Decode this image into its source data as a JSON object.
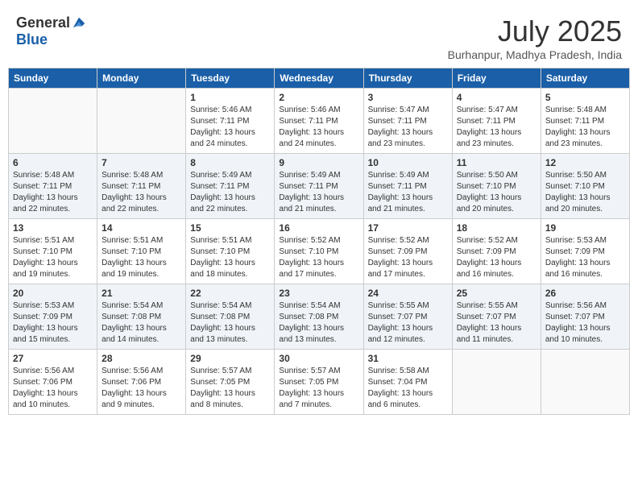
{
  "header": {
    "logo_general": "General",
    "logo_blue": "Blue",
    "month_year": "July 2025",
    "location": "Burhanpur, Madhya Pradesh, India"
  },
  "days_of_week": [
    "Sunday",
    "Monday",
    "Tuesday",
    "Wednesday",
    "Thursday",
    "Friday",
    "Saturday"
  ],
  "weeks": [
    {
      "shade": false,
      "days": [
        {
          "num": "",
          "sunrise": "",
          "sunset": "",
          "daylight": ""
        },
        {
          "num": "",
          "sunrise": "",
          "sunset": "",
          "daylight": ""
        },
        {
          "num": "1",
          "sunrise": "Sunrise: 5:46 AM",
          "sunset": "Sunset: 7:11 PM",
          "daylight": "Daylight: 13 hours and 24 minutes."
        },
        {
          "num": "2",
          "sunrise": "Sunrise: 5:46 AM",
          "sunset": "Sunset: 7:11 PM",
          "daylight": "Daylight: 13 hours and 24 minutes."
        },
        {
          "num": "3",
          "sunrise": "Sunrise: 5:47 AM",
          "sunset": "Sunset: 7:11 PM",
          "daylight": "Daylight: 13 hours and 23 minutes."
        },
        {
          "num": "4",
          "sunrise": "Sunrise: 5:47 AM",
          "sunset": "Sunset: 7:11 PM",
          "daylight": "Daylight: 13 hours and 23 minutes."
        },
        {
          "num": "5",
          "sunrise": "Sunrise: 5:48 AM",
          "sunset": "Sunset: 7:11 PM",
          "daylight": "Daylight: 13 hours and 23 minutes."
        }
      ]
    },
    {
      "shade": true,
      "days": [
        {
          "num": "6",
          "sunrise": "Sunrise: 5:48 AM",
          "sunset": "Sunset: 7:11 PM",
          "daylight": "Daylight: 13 hours and 22 minutes."
        },
        {
          "num": "7",
          "sunrise": "Sunrise: 5:48 AM",
          "sunset": "Sunset: 7:11 PM",
          "daylight": "Daylight: 13 hours and 22 minutes."
        },
        {
          "num": "8",
          "sunrise": "Sunrise: 5:49 AM",
          "sunset": "Sunset: 7:11 PM",
          "daylight": "Daylight: 13 hours and 22 minutes."
        },
        {
          "num": "9",
          "sunrise": "Sunrise: 5:49 AM",
          "sunset": "Sunset: 7:11 PM",
          "daylight": "Daylight: 13 hours and 21 minutes."
        },
        {
          "num": "10",
          "sunrise": "Sunrise: 5:49 AM",
          "sunset": "Sunset: 7:11 PM",
          "daylight": "Daylight: 13 hours and 21 minutes."
        },
        {
          "num": "11",
          "sunrise": "Sunrise: 5:50 AM",
          "sunset": "Sunset: 7:10 PM",
          "daylight": "Daylight: 13 hours and 20 minutes."
        },
        {
          "num": "12",
          "sunrise": "Sunrise: 5:50 AM",
          "sunset": "Sunset: 7:10 PM",
          "daylight": "Daylight: 13 hours and 20 minutes."
        }
      ]
    },
    {
      "shade": false,
      "days": [
        {
          "num": "13",
          "sunrise": "Sunrise: 5:51 AM",
          "sunset": "Sunset: 7:10 PM",
          "daylight": "Daylight: 13 hours and 19 minutes."
        },
        {
          "num": "14",
          "sunrise": "Sunrise: 5:51 AM",
          "sunset": "Sunset: 7:10 PM",
          "daylight": "Daylight: 13 hours and 19 minutes."
        },
        {
          "num": "15",
          "sunrise": "Sunrise: 5:51 AM",
          "sunset": "Sunset: 7:10 PM",
          "daylight": "Daylight: 13 hours and 18 minutes."
        },
        {
          "num": "16",
          "sunrise": "Sunrise: 5:52 AM",
          "sunset": "Sunset: 7:10 PM",
          "daylight": "Daylight: 13 hours and 17 minutes."
        },
        {
          "num": "17",
          "sunrise": "Sunrise: 5:52 AM",
          "sunset": "Sunset: 7:09 PM",
          "daylight": "Daylight: 13 hours and 17 minutes."
        },
        {
          "num": "18",
          "sunrise": "Sunrise: 5:52 AM",
          "sunset": "Sunset: 7:09 PM",
          "daylight": "Daylight: 13 hours and 16 minutes."
        },
        {
          "num": "19",
          "sunrise": "Sunrise: 5:53 AM",
          "sunset": "Sunset: 7:09 PM",
          "daylight": "Daylight: 13 hours and 16 minutes."
        }
      ]
    },
    {
      "shade": true,
      "days": [
        {
          "num": "20",
          "sunrise": "Sunrise: 5:53 AM",
          "sunset": "Sunset: 7:09 PM",
          "daylight": "Daylight: 13 hours and 15 minutes."
        },
        {
          "num": "21",
          "sunrise": "Sunrise: 5:54 AM",
          "sunset": "Sunset: 7:08 PM",
          "daylight": "Daylight: 13 hours and 14 minutes."
        },
        {
          "num": "22",
          "sunrise": "Sunrise: 5:54 AM",
          "sunset": "Sunset: 7:08 PM",
          "daylight": "Daylight: 13 hours and 13 minutes."
        },
        {
          "num": "23",
          "sunrise": "Sunrise: 5:54 AM",
          "sunset": "Sunset: 7:08 PM",
          "daylight": "Daylight: 13 hours and 13 minutes."
        },
        {
          "num": "24",
          "sunrise": "Sunrise: 5:55 AM",
          "sunset": "Sunset: 7:07 PM",
          "daylight": "Daylight: 13 hours and 12 minutes."
        },
        {
          "num": "25",
          "sunrise": "Sunrise: 5:55 AM",
          "sunset": "Sunset: 7:07 PM",
          "daylight": "Daylight: 13 hours and 11 minutes."
        },
        {
          "num": "26",
          "sunrise": "Sunrise: 5:56 AM",
          "sunset": "Sunset: 7:07 PM",
          "daylight": "Daylight: 13 hours and 10 minutes."
        }
      ]
    },
    {
      "shade": false,
      "days": [
        {
          "num": "27",
          "sunrise": "Sunrise: 5:56 AM",
          "sunset": "Sunset: 7:06 PM",
          "daylight": "Daylight: 13 hours and 10 minutes."
        },
        {
          "num": "28",
          "sunrise": "Sunrise: 5:56 AM",
          "sunset": "Sunset: 7:06 PM",
          "daylight": "Daylight: 13 hours and 9 minutes."
        },
        {
          "num": "29",
          "sunrise": "Sunrise: 5:57 AM",
          "sunset": "Sunset: 7:05 PM",
          "daylight": "Daylight: 13 hours and 8 minutes."
        },
        {
          "num": "30",
          "sunrise": "Sunrise: 5:57 AM",
          "sunset": "Sunset: 7:05 PM",
          "daylight": "Daylight: 13 hours and 7 minutes."
        },
        {
          "num": "31",
          "sunrise": "Sunrise: 5:58 AM",
          "sunset": "Sunset: 7:04 PM",
          "daylight": "Daylight: 13 hours and 6 minutes."
        },
        {
          "num": "",
          "sunrise": "",
          "sunset": "",
          "daylight": ""
        },
        {
          "num": "",
          "sunrise": "",
          "sunset": "",
          "daylight": ""
        }
      ]
    }
  ]
}
